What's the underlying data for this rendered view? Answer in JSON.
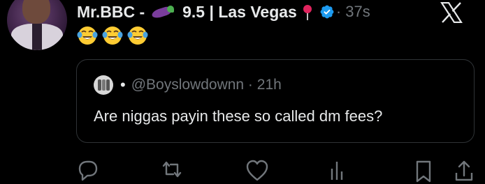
{
  "post": {
    "author_name": "Mr.BBC -",
    "author_emoji": "eggplant-emoji",
    "location_text": "9.5 | Las Vegas",
    "location_emoji": "round-pushpin-emoji",
    "verified_icon": "verified-badge-icon",
    "timestamp": "· 37s",
    "platform_logo": "x-logo-icon",
    "reaction_emojis": [
      "face-with-tears-of-joy-emoji",
      "face-with-tears-of-joy-emoji",
      "face-with-tears-of-joy-emoji"
    ]
  },
  "quote": {
    "handle_line": "@Boyslowdownn · 21h",
    "separator": "•",
    "text": "Are niggas payin these so called dm fees?"
  },
  "actions": [
    {
      "name": "reply-icon"
    },
    {
      "name": "repost-icon"
    },
    {
      "name": "like-icon"
    },
    {
      "name": "views-icon"
    },
    {
      "name": "bookmark-icon"
    },
    {
      "name": "share-icon"
    }
  ],
  "colors": {
    "background": "#000000",
    "primary_text": "#e7e9ea",
    "secondary_text": "#71767b",
    "verified_blue": "#1d9bf0",
    "border": "#2f3336",
    "pin_red": "#e0245e",
    "eggplant_purple": "#7a3d9c"
  }
}
